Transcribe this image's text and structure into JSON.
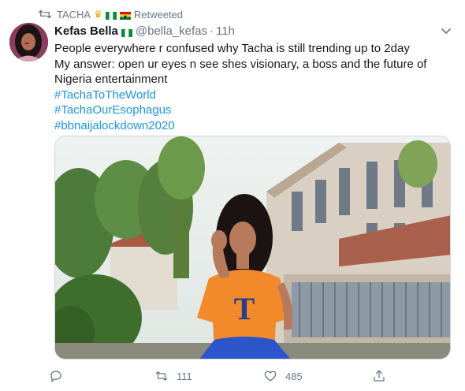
{
  "retweet": {
    "user": "TACHA",
    "label": "Retweeted"
  },
  "tweet": {
    "display_name": "Kefas Bella",
    "handle": "@bella_kefas",
    "separator": "·",
    "time": "11h",
    "lines": [
      "People everywhere r confused why Tacha is still trending up to 2day",
      "My answer: open ur eyes n see shes visionary, a boss and the future of",
      "Nigeria entertainment"
    ],
    "hashtags": [
      "#TachaToTheWorld",
      "#TachaOurEsophagus",
      "#bbnaijalockdown2020"
    ]
  },
  "media": {
    "shirt_letter": "T"
  },
  "actions": {
    "reply_count": "",
    "retweet_count": "111",
    "like_count": "485"
  },
  "icons": {
    "retweet_header": "retweet-icon",
    "caret": "chevron-down-icon",
    "reply": "reply-icon",
    "retweet": "retweet-icon",
    "like": "heart-icon",
    "share": "share-icon"
  },
  "colors": {
    "link": "#1b95e0",
    "muted": "#657786",
    "text": "#14171a",
    "shirt": "#f28a2c",
    "skirt": "#2b55c9"
  }
}
